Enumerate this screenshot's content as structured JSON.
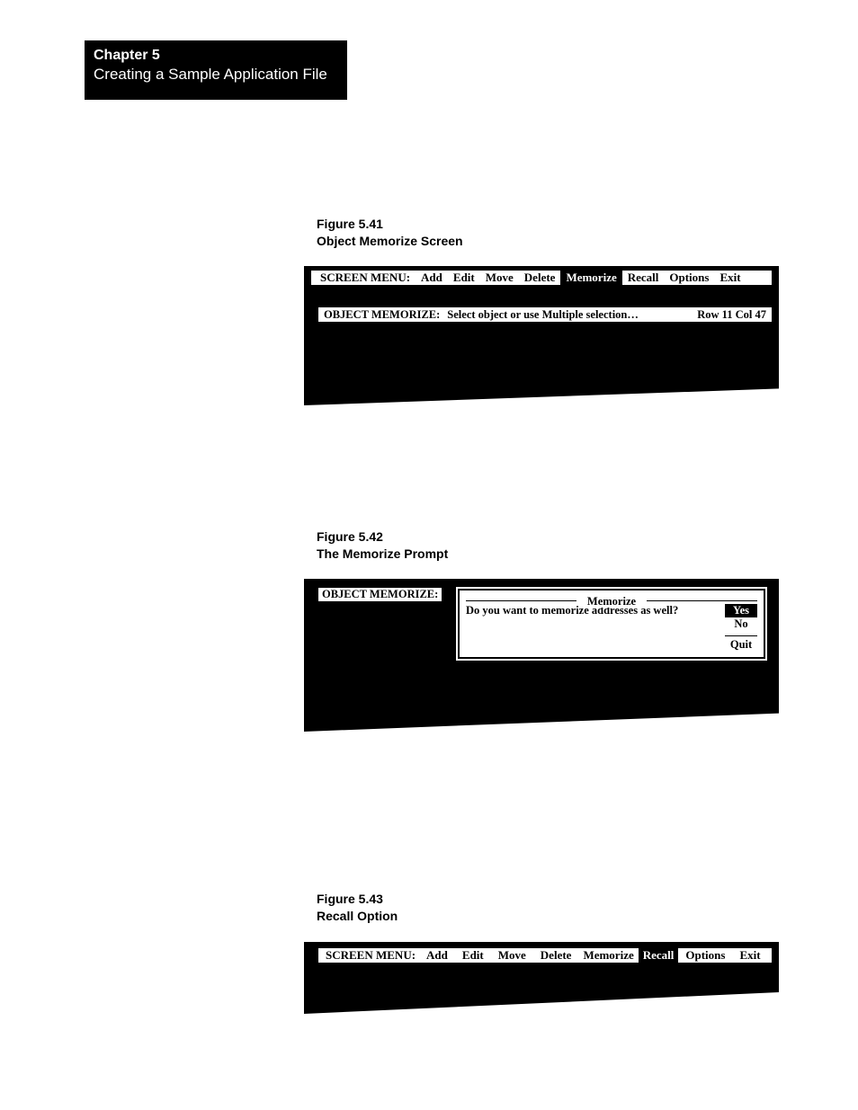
{
  "chapter": {
    "num": "Chapter 5",
    "title": "Creating a Sample Application File"
  },
  "fig41": {
    "num": "Figure 5.41",
    "title": "Object Memorize Screen",
    "menu_label": "SCREEN MENU:",
    "items": {
      "add": "Add",
      "edit": "Edit",
      "move": "Move",
      "delete": "Delete",
      "memorize": "Memorize",
      "recall": "Recall",
      "options": "Options",
      "exit": "Exit"
    },
    "status_label": "OBJECT MEMORIZE:",
    "status_msg": "Select object or use Multiple selection…",
    "status_pos": "Row 11 Col 47"
  },
  "fig42": {
    "num": "Figure 5.42",
    "title": "The Memorize Prompt",
    "bar_label": "OBJECT MEMORIZE:",
    "dialog_title": "Memorize",
    "prompt": "Do you want to memorize addresses as well?",
    "yes": "Yes",
    "no": "No",
    "quit": "Quit"
  },
  "fig43": {
    "num": "Figure 5.43",
    "title": "Recall Option",
    "menu_label": "SCREEN MENU:",
    "items": {
      "add": "Add",
      "edit": "Edit",
      "move": "Move",
      "delete": "Delete",
      "memorize": "Memorize",
      "recall": "Recall",
      "options": "Options",
      "exit": "Exit"
    }
  }
}
